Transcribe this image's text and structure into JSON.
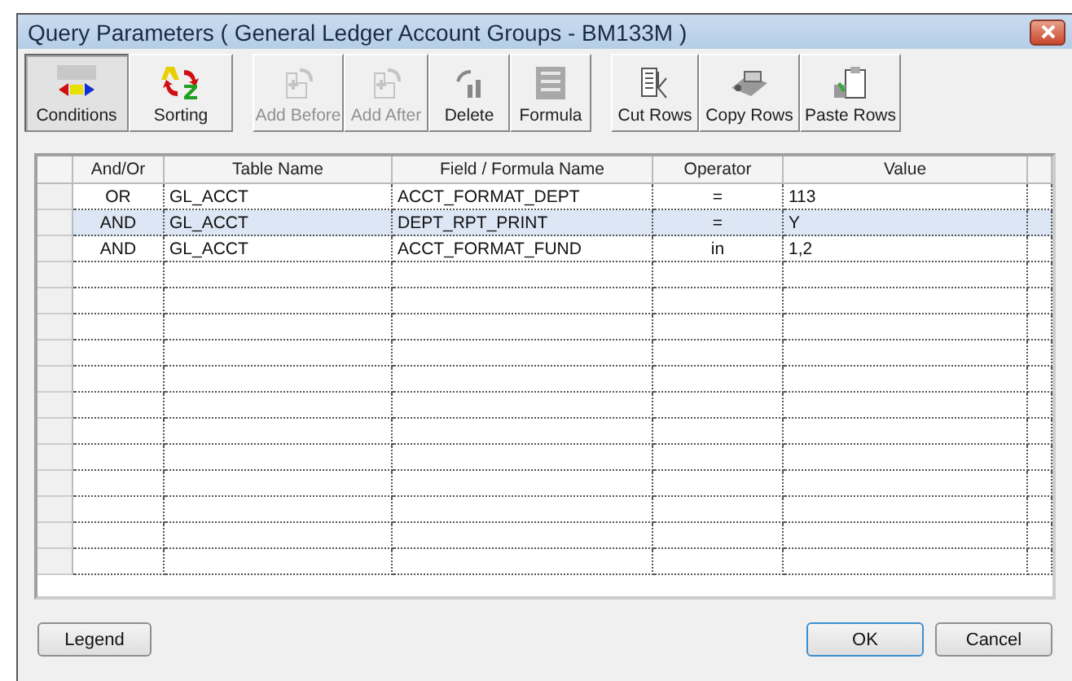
{
  "window": {
    "title": "Query Parameters ( General Ledger Account Groups - BM133M )"
  },
  "view_tabs": [
    {
      "label": "Conditions",
      "selected": true
    },
    {
      "label": "Sorting",
      "selected": false
    }
  ],
  "toolbar": [
    {
      "label": "Add Before",
      "disabled": true
    },
    {
      "label": "Add After",
      "disabled": true
    },
    {
      "label": "Delete",
      "disabled": false
    },
    {
      "label": "Formula",
      "disabled": false
    },
    {
      "label": "Cut Rows",
      "disabled": false
    },
    {
      "label": "Copy Rows",
      "disabled": false
    },
    {
      "label": "Paste Rows",
      "disabled": false
    }
  ],
  "table": {
    "columns": [
      "And/Or",
      "Table Name",
      "Field / Formula Name",
      "Operator",
      "Value"
    ],
    "rows": [
      {
        "cells": [
          "OR",
          "GL_ACCT",
          "ACCT_FORMAT_DEPT",
          "=",
          "113"
        ],
        "selected": false
      },
      {
        "cells": [
          "AND",
          "GL_ACCT",
          "DEPT_RPT_PRINT",
          "=",
          "Y"
        ],
        "selected": true
      },
      {
        "cells": [
          "AND",
          "GL_ACCT",
          "ACCT_FORMAT_FUND",
          "in",
          "1,2"
        ],
        "selected": false
      }
    ]
  },
  "buttons": {
    "legend": "Legend",
    "ok": "OK",
    "cancel": "Cancel"
  }
}
